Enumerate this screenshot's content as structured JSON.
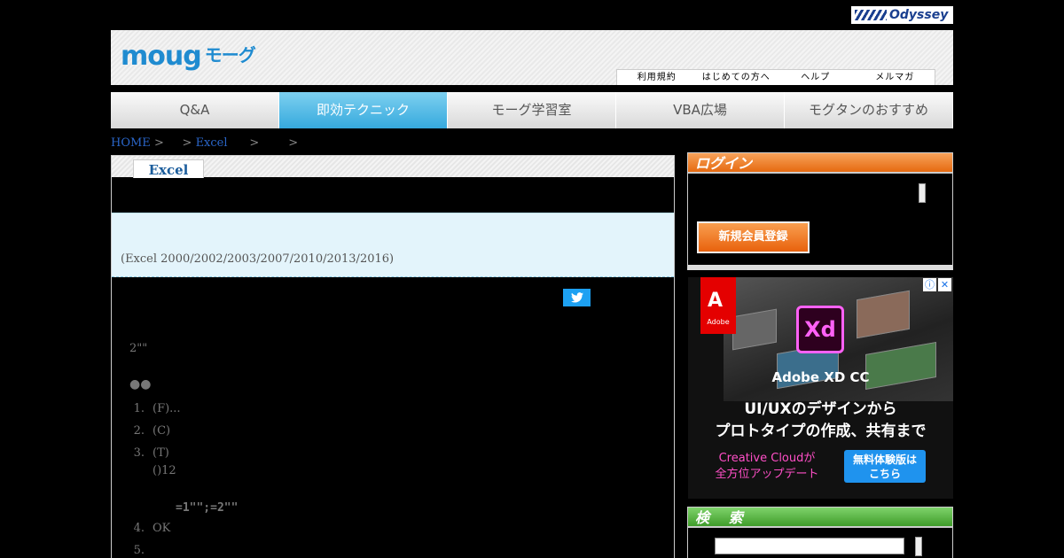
{
  "brand": {
    "odyssey": "Odyssey"
  },
  "header": {
    "logo_text": "moug",
    "logo_kana": "モーグ",
    "util_links": [
      "利用規約",
      "はじめての方へ",
      "ヘルプ",
      "メルマガ"
    ]
  },
  "nav": {
    "items": [
      "Q&A",
      "即効テクニック",
      "モーグ学習室",
      "VBA広場",
      "モグタンのおすすめ"
    ],
    "active_index": 1
  },
  "breadcrumb": {
    "home": "HOME",
    "sep": ">",
    "excel": "Excel"
  },
  "article": {
    "tab": "Excel",
    "versions": "(Excel 2000/2002/2003/2007/2010/2013/2016)",
    "intro": "2\"\"",
    "bullets": "●●",
    "steps": [
      {
        "num": "1.",
        "text": "(F)..."
      },
      {
        "num": "2.",
        "text": "(C)"
      },
      {
        "num": "3.",
        "text": "(T)",
        "sub": "()12"
      },
      {
        "num": "4.",
        "text": "OK"
      },
      {
        "num": "5.",
        "text": ""
      }
    ],
    "formula": "=1\"\";=2\"\""
  },
  "sidebar": {
    "login_title": "ログイン",
    "register_button": "新規会員登録",
    "search_title": "検 索"
  },
  "ad": {
    "adobe": "Adobe",
    "xd": "Xd",
    "title": "Adobe XD CC",
    "line1": "UI/UXのデザインから",
    "line2": "プロトタイプの作成、共有まで",
    "cc_line1": "Creative Cloudが",
    "cc_line2": "全方位アップデート",
    "trial_line1": "無料体験版は",
    "trial_line2": "こちら"
  },
  "colors": {
    "accent_blue": "#1f8bd0",
    "nav_active": "#36a9dd",
    "login_orange": "#e66a10",
    "search_green": "#3f9c2a",
    "info_bg": "#e3f4fb"
  }
}
